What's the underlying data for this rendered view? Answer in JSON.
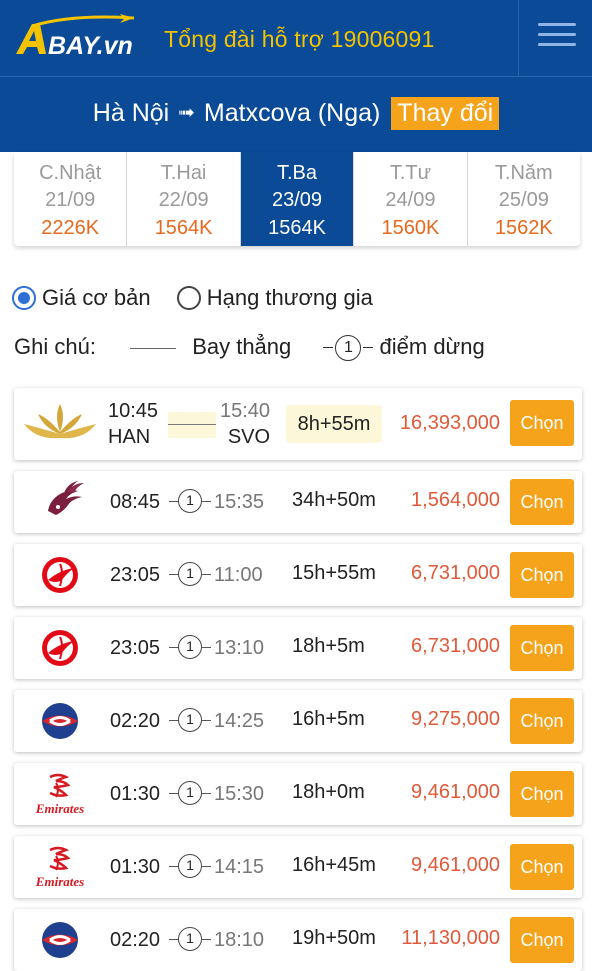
{
  "header": {
    "logo_text": "BAY.vn",
    "hotline": "Tổng đài hỗ trợ 19006091",
    "menu_icon": "hamburger-menu-icon"
  },
  "route": {
    "origin": "Hà Nội",
    "arrow": "➟",
    "destination": "Matxcova (Nga)",
    "change_label": "Thay đổi"
  },
  "date_tabs": [
    {
      "day": "C.Nhật",
      "date": "21/09",
      "price": "2226K",
      "active": false
    },
    {
      "day": "T.Hai",
      "date": "22/09",
      "price": "1564K",
      "active": false
    },
    {
      "day": "T.Ba",
      "date": "23/09",
      "price": "1564K",
      "active": true
    },
    {
      "day": "T.Tư",
      "date": "24/09",
      "price": "1560K",
      "active": false
    },
    {
      "day": "T.Năm",
      "date": "25/09",
      "price": "1562K",
      "active": false
    }
  ],
  "fare_options": {
    "basic": "Giá cơ bản",
    "business": "Hạng thương gia",
    "selected": "basic"
  },
  "legend": {
    "label": "Ghi chú:",
    "direct": "Bay thẳng",
    "stop_number": "1",
    "stop": "điểm dừng"
  },
  "flights": [
    {
      "airline_icon": "vietnam-airlines-lotus-icon",
      "dep": "10:45",
      "dep_code": "HAN",
      "arr": "15:40",
      "arr_code": "SVO",
      "stops": "",
      "duration": "8h+55m",
      "price": "16,393,000",
      "button": "Chọn"
    },
    {
      "airline_icon": "qatar-airways-oryx-icon",
      "dep": "08:45",
      "arr": "15:35",
      "stops": "1",
      "duration": "34h+50m",
      "price": "1,564,000",
      "button": "Chọn"
    },
    {
      "airline_icon": "turkish-airlines-icon",
      "dep": "23:05",
      "arr": "11:00",
      "stops": "1",
      "duration": "15h+55m",
      "price": "6,731,000",
      "button": "Chọn"
    },
    {
      "airline_icon": "turkish-airlines-icon",
      "dep": "23:05",
      "arr": "13:10",
      "stops": "1",
      "duration": "18h+5m",
      "price": "6,731,000",
      "button": "Chọn"
    },
    {
      "airline_icon": "china-eastern-icon",
      "dep": "02:20",
      "arr": "14:25",
      "stops": "1",
      "duration": "16h+5m",
      "price": "9,275,000",
      "button": "Chọn"
    },
    {
      "airline_icon": "emirates-icon",
      "dep": "01:30",
      "arr": "15:30",
      "stops": "1",
      "duration": "18h+0m",
      "price": "9,461,000",
      "button": "Chọn"
    },
    {
      "airline_icon": "emirates-icon",
      "dep": "01:30",
      "arr": "14:15",
      "stops": "1",
      "duration": "16h+45m",
      "price": "9,461,000",
      "button": "Chọn"
    },
    {
      "airline_icon": "china-eastern-icon",
      "dep": "02:20",
      "arr": "18:10",
      "stops": "1",
      "duration": "19h+50m",
      "price": "11,130,000",
      "button": "Chọn"
    }
  ],
  "colors": {
    "brand_blue": "#0b4a97",
    "accent_orange": "#f5a31a",
    "hotline_yellow": "#f3c300",
    "price_red": "#e05a3a"
  }
}
